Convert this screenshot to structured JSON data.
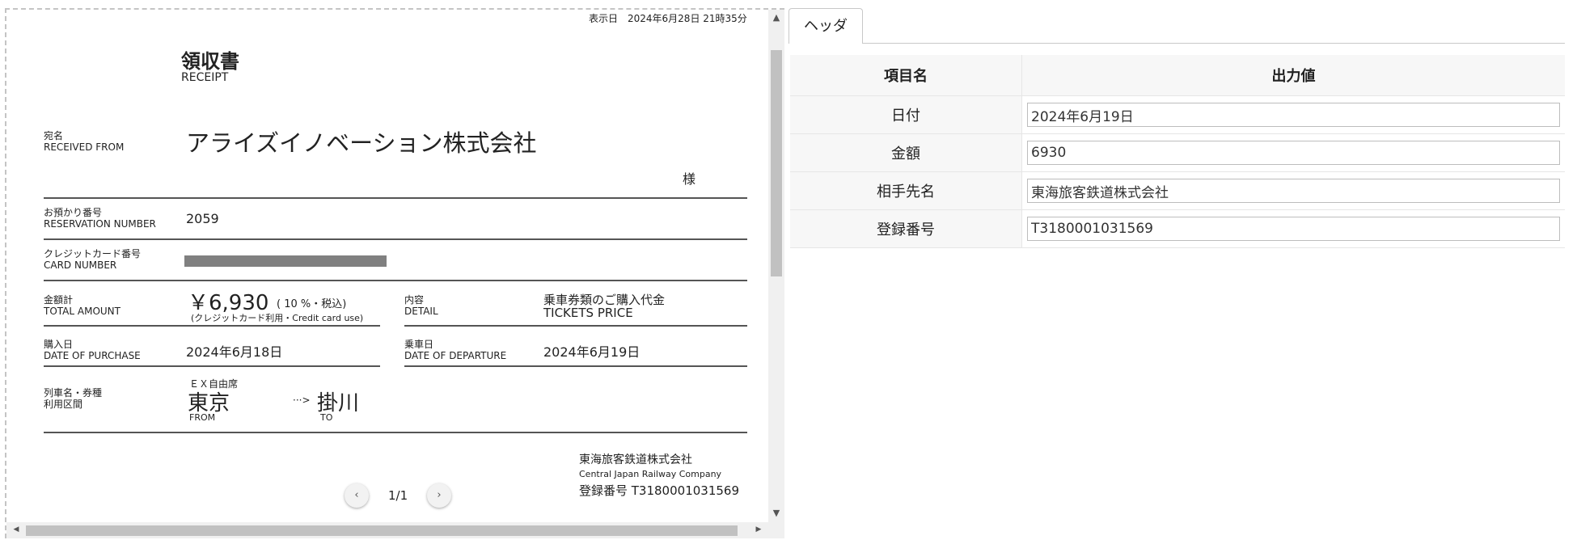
{
  "doc": {
    "display_date": "表示日　2024年6月28日 21時35分",
    "title_ja": "領収書",
    "title_en": "RECEIPT",
    "addressee_label_ja": "宛名",
    "addressee_label_en": "RECEIVED FROM",
    "addressee": "アライズイノベーション株式会社",
    "honorific": "様",
    "reservation_label_ja": "お預かり番号",
    "reservation_label_en": "RESERVATION NUMBER",
    "reservation_number": "2059",
    "card_label_ja": "クレジットカード番号",
    "card_label_en": "CARD NUMBER",
    "total_label_ja": "金額計",
    "total_label_en": "TOTAL AMOUNT",
    "total_amount": "￥6,930",
    "tax_note": "( 10 %・税込)",
    "payment_note": "(クレジットカード利用・Credit card use)",
    "detail_label_ja": "内容",
    "detail_label_en": "DETAIL",
    "detail_ja": "乗車券類のご購入代金",
    "detail_en": "TICKETS PRICE",
    "purchase_label_ja": "購入日",
    "purchase_label_en": "DATE OF PURCHASE",
    "purchase_date": "2024年6月18日",
    "departure_label_ja": "乗車日",
    "departure_label_en": "DATE OF DEPARTURE",
    "departure_date": "2024年6月19日",
    "train_label_1": "列車名・券種",
    "train_label_2": "利用区間",
    "seat_type": "ＥＸ自由席",
    "from": "東京",
    "from_en": "FROM",
    "to": "掛川",
    "to_en": "TO",
    "route_arrow": "···>",
    "issuer_ja": "東海旅客鉄道株式会社",
    "issuer_en": "Central Japan Railway Company",
    "issuer_reg": "登録番号 T3180001031569"
  },
  "pager": {
    "prev": "‹",
    "label": "1/1",
    "next": "›"
  },
  "scrollbar": {
    "up": "▲",
    "down": "▼",
    "left": "◀",
    "right": "▶"
  },
  "panel": {
    "tab": "ヘッダ",
    "col_item": "項目名",
    "col_value": "出力値",
    "rows": [
      {
        "label": "日付",
        "value": "2024年6月19日"
      },
      {
        "label": "金額",
        "value": "6930"
      },
      {
        "label": "相手先名",
        "value": "東海旅客鉄道株式会社"
      },
      {
        "label": "登録番号",
        "value": "T3180001031569"
      }
    ]
  }
}
